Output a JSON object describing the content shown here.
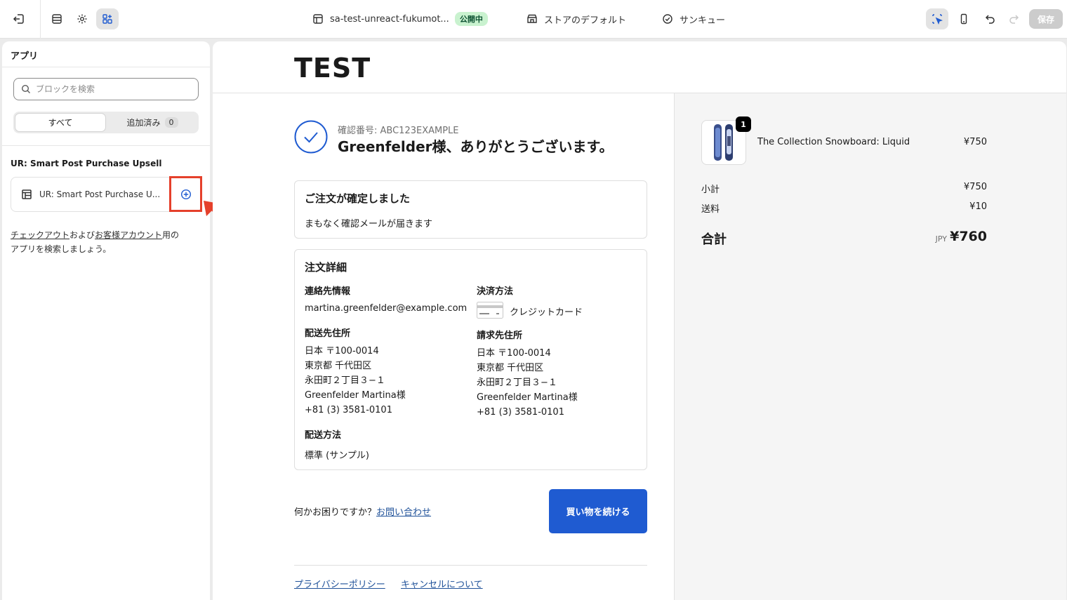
{
  "topbar": {
    "theme_name": "sa-test-unreact-fukumot...",
    "live_badge": "公開中",
    "store_default": "ストアのデフォルト",
    "page_name": "サンキュー",
    "save_label": "保存"
  },
  "sidebar": {
    "title": "アプリ",
    "search_placeholder": "ブロックを検索",
    "tab_all": "すべて",
    "tab_added": "追加済み",
    "tab_added_count": "0",
    "app_heading": "UR: Smart Post Purchase Upsell",
    "app_block_label": "UR: Smart Post Purchase U...",
    "help_link_checkout": "チェックアウト",
    "help_and": "および",
    "help_link_account": "お客様アカウント",
    "help_suffix_1": "用の",
    "help_suffix_2": "アプリを検索しましょう。"
  },
  "preview": {
    "store_logo": "TEST",
    "confirmation_number": "確認番号: ABC123EXAMPLE",
    "thanks_message": "Greenfelder様、ありがとうございます。",
    "confirmed_card": {
      "title": "ご注文が確定しました",
      "text": "まもなく確認メールが届きます"
    },
    "details_card": {
      "title": "注文詳細",
      "contact_heading": "連絡先情報",
      "contact_email": "martina.greenfelder@example.com",
      "payment_heading": "決済方法",
      "payment_method": "クレジットカード",
      "shipping_address_heading": "配送先住所",
      "shipping_address": [
        "日本 〒100-0014",
        "東京都 千代田区",
        "永田町２丁目３−１",
        "Greenfelder Martina様",
        "+81 (3) 3581-0101"
      ],
      "billing_address_heading": "請求先住所",
      "billing_address": [
        "日本 〒100-0014",
        "東京都 千代田区",
        "永田町２丁目３−１",
        "Greenfelder Martina様",
        "+81 (3) 3581-0101"
      ],
      "shipping_method_heading": "配送方法",
      "shipping_method": "標準 (サンプル)"
    },
    "help_text": "何かお困りですか？",
    "help_link": "お問い合わせ",
    "continue_button": "買い物を続ける",
    "footer_privacy": "プライバシーポリシー",
    "footer_cancel": "キャンセルについて"
  },
  "summary": {
    "product_qty": "1",
    "product_name": "The Collection Snowboard: Liquid",
    "product_price": "¥750",
    "subtotal_label": "小計",
    "subtotal_value": "¥750",
    "shipping_label": "送料",
    "shipping_value": "¥10",
    "total_label": "合計",
    "total_currency": "JPY",
    "total_value": "¥760"
  },
  "colors": {
    "accent_button": "#1f5bd1",
    "link": "#1f5199",
    "highlight_annotation": "#e5402b",
    "live_badge_bg": "#c9f2cf"
  }
}
